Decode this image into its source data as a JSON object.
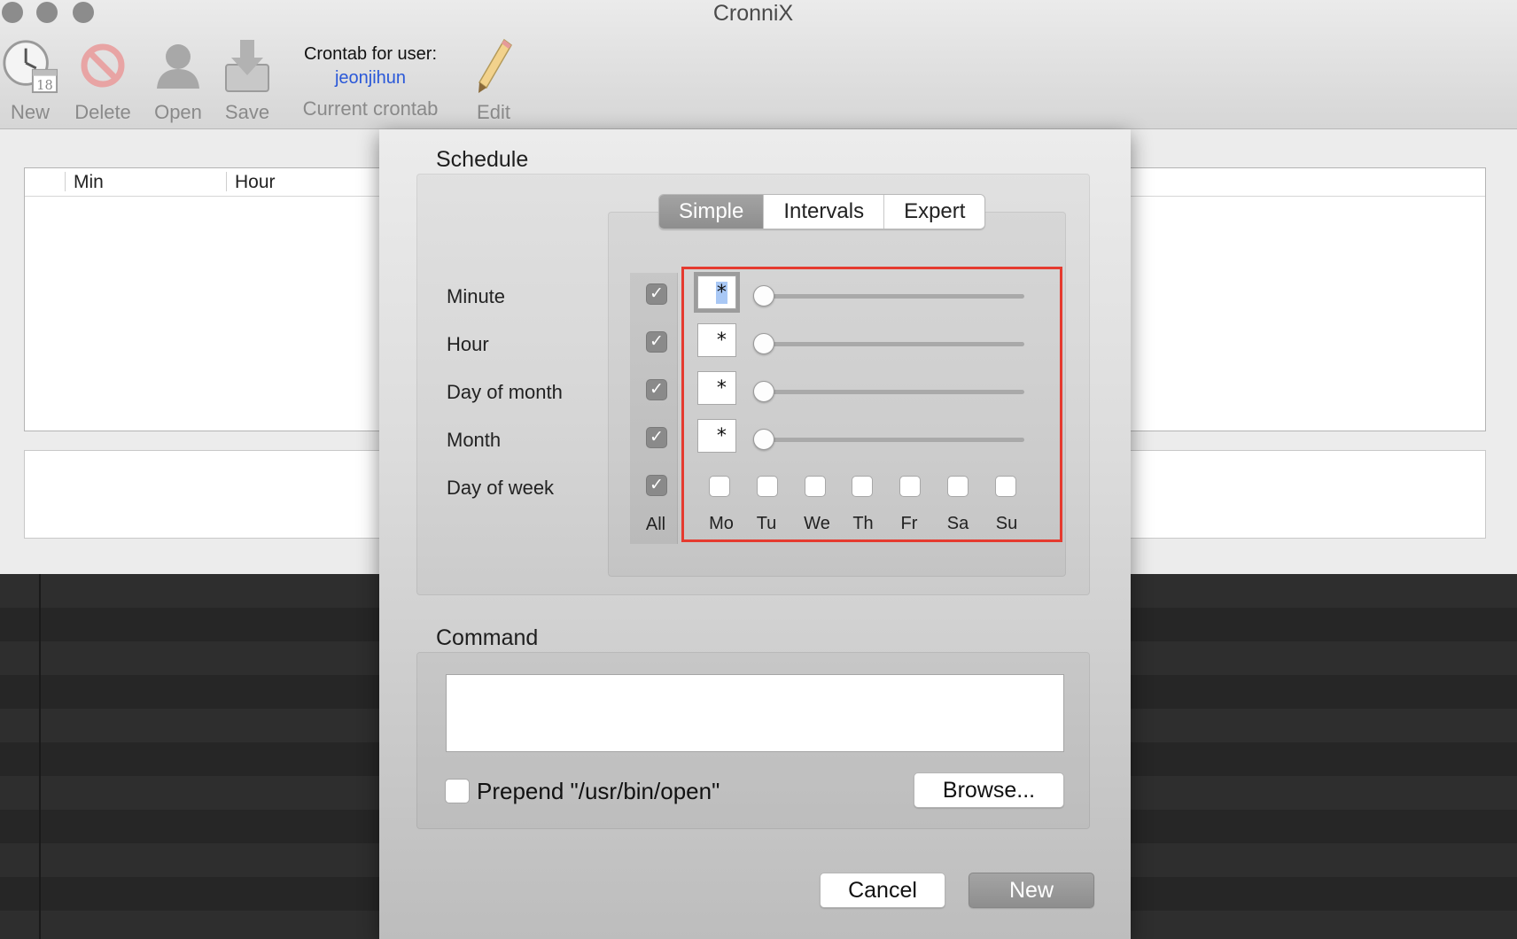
{
  "app": {
    "title": "CronniX"
  },
  "toolbar": {
    "items": [
      {
        "label": "New",
        "icon": "clock-calendar-icon"
      },
      {
        "label": "Delete",
        "icon": "no-entry-icon"
      },
      {
        "label": "Open",
        "icon": "person-icon"
      },
      {
        "label": "Save",
        "icon": "disk-download-icon"
      },
      {
        "label": "Edit",
        "icon": "pencil-icon"
      }
    ],
    "crontab": {
      "title": "Crontab for user:",
      "user": "jeonjihun",
      "label": "Current crontab"
    }
  },
  "table": {
    "columns": [
      "Min",
      "Hour"
    ]
  },
  "sheet": {
    "schedule_title": "Schedule",
    "tabs": [
      "Simple",
      "Intervals",
      "Expert"
    ],
    "active_tab": "Simple",
    "rows": [
      {
        "label": "Minute",
        "value": "*",
        "all": true
      },
      {
        "label": "Hour",
        "value": "*",
        "all": true
      },
      {
        "label": "Day of month",
        "value": "*",
        "all": true
      },
      {
        "label": "Month",
        "value": "*",
        "all": true
      },
      {
        "label": "Day of week",
        "all": true
      }
    ],
    "all_label": "All",
    "days": [
      "Mo",
      "Tu",
      "We",
      "Th",
      "Fr",
      "Sa",
      "Su"
    ],
    "command_title": "Command",
    "command_value": "",
    "prepend_label": "Prepend \"/usr/bin/open\"",
    "prepend_checked": false,
    "browse_label": "Browse...",
    "cancel_label": "Cancel",
    "new_label": "New"
  },
  "colors": {
    "highlight": "#e53a2f",
    "user_link": "#2a58d8",
    "segment_selected": "#9a9a9a"
  }
}
